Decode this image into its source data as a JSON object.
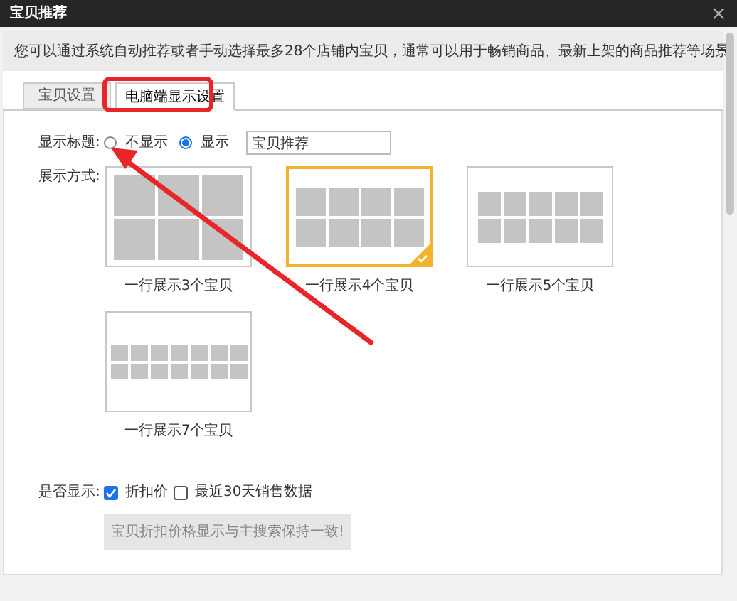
{
  "window": {
    "title": "宝贝推荐",
    "close": "×"
  },
  "info": "您可以通过系统自动推荐或者手动选择最多28个店铺内宝贝，通常可以用于畅销商品、最新上架的商品推荐等场景",
  "tabs": [
    {
      "label": "宝贝设置",
      "selected": false
    },
    {
      "label": "电脑端显示设置",
      "selected": true
    }
  ],
  "title_setting": {
    "label": "显示标题:",
    "options": [
      {
        "label": "不显示",
        "selected": false
      },
      {
        "label": "显示",
        "selected": true
      }
    ],
    "value": "宝贝推荐"
  },
  "layout": {
    "label": "展示方式:",
    "options": [
      {
        "kind": "cols3",
        "label": "一行展示3个宝贝",
        "selected": false
      },
      {
        "kind": "cols4",
        "label": "一行展示4个宝贝",
        "selected": true
      },
      {
        "kind": "cols5",
        "label": "一行展示5个宝贝",
        "selected": false
      },
      {
        "kind": "cols7",
        "label": "一行展示7个宝贝",
        "selected": false
      }
    ]
  },
  "display": {
    "label": "是否显示:",
    "options": [
      {
        "label": "折扣价",
        "checked": true
      },
      {
        "label": "最近30天销售数据",
        "checked": false
      }
    ],
    "note": "宝贝折扣价格显示与主搜索保持一致!"
  },
  "annotations": {
    "tab_frame": true,
    "arrow": true
  }
}
